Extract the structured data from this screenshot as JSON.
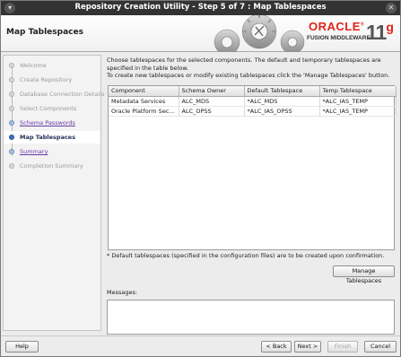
{
  "window": {
    "title": "Repository Creation Utility - Step 5 of 7 : Map Tablespaces",
    "menu_glyph": "▾",
    "close_glyph": "✕"
  },
  "banner": {
    "page_title": "Map Tablespaces",
    "brand": "ORACLE",
    "brand_mark": "®",
    "product": "FUSION MIDDLEWARE",
    "version_number": "11",
    "version_letter": "g",
    "accent_color": "#e2231a"
  },
  "nav": {
    "items": [
      {
        "label": "Welcome",
        "state": "done"
      },
      {
        "label": "Create Repository",
        "state": "done"
      },
      {
        "label": "Database Connection Details",
        "state": "done"
      },
      {
        "label": "Select Components",
        "state": "done"
      },
      {
        "label": "Schema Passwords",
        "state": "link"
      },
      {
        "label": "Map Tablespaces",
        "state": "current"
      },
      {
        "label": "Summary",
        "state": "link"
      },
      {
        "label": "Completion Summary",
        "state": "disabled"
      }
    ]
  },
  "main": {
    "intro_line1": "Choose tablespaces for the selected components. The default and temporary tablespaces are specified in the table below.",
    "intro_line2": "To create new tablespaces or modify existing tablespaces click the 'Manage Tablespaces' button.",
    "table": {
      "columns": [
        "Component",
        "Schema Owner",
        "Default Tablespace",
        "Temp Tablespace"
      ],
      "rows": [
        [
          "Metadata Services",
          "ALC_MDS",
          "*ALC_MDS",
          "*ALC_IAS_TEMP"
        ],
        [
          "Oracle Platform Secu...",
          "ALC_OPSS",
          "*ALC_IAS_OPSS",
          "*ALC_IAS_TEMP"
        ]
      ]
    },
    "footnote": "* Default tablespaces (specified in the configuration files) are to be created upon confirmation.",
    "manage_button": "Manage Tablespaces",
    "messages_label": "Messages:",
    "messages_text": ""
  },
  "buttons": {
    "help": "Help",
    "back": "< Back",
    "next": "Next >",
    "finish": "Finish",
    "cancel": "Cancel"
  }
}
